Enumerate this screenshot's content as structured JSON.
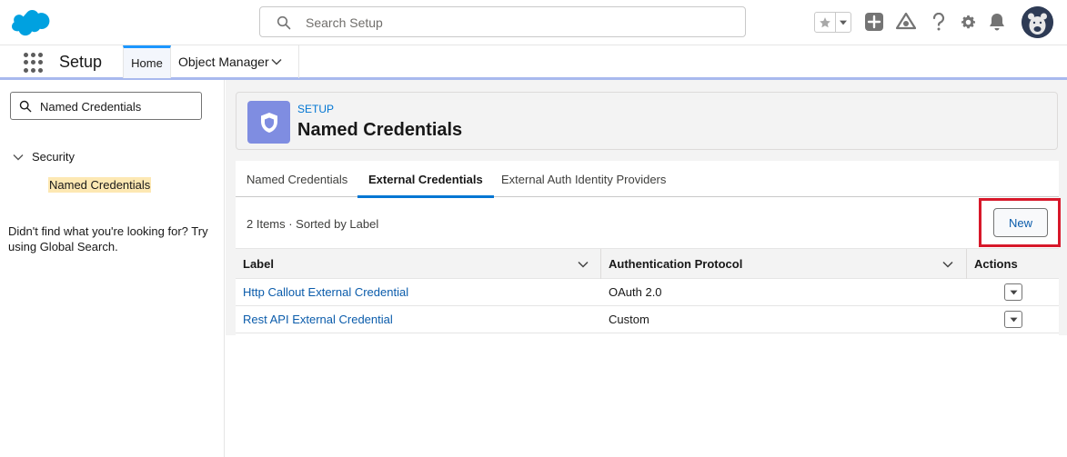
{
  "header": {
    "search_placeholder": "Search Setup",
    "brand_color": "#00a1e0",
    "icons": [
      "favorites-star-icon",
      "favorites-dropdown-icon",
      "global-actions-plus-icon",
      "trailhead-icon",
      "help-icon",
      "setup-gear-icon",
      "notifications-bell-icon",
      "user-avatar"
    ]
  },
  "app_nav": {
    "app_name": "Setup",
    "tabs": [
      {
        "label": "Home",
        "active": true
      },
      {
        "label": "Object Manager",
        "active": false
      }
    ]
  },
  "sidebar": {
    "quick_find_value": "Named Credentials",
    "tree": {
      "node_label": "Security",
      "leaf_label": "Named Credentials"
    },
    "not_found_text": "Didn't find what you're looking for? Try using Global Search."
  },
  "page_header": {
    "eyebrow": "SETUP",
    "title": "Named Credentials",
    "icon": "shield-icon"
  },
  "tabs": [
    {
      "label": "Named Credentials",
      "active": false
    },
    {
      "label": "External Credentials",
      "active": true
    },
    {
      "label": "External Auth Identity Providers",
      "active": false
    }
  ],
  "list": {
    "info": "2 Items · Sorted by Label",
    "new_button": "New",
    "columns": [
      "Label",
      "Authentication Protocol",
      "Actions"
    ],
    "rows": [
      {
        "label": "Http Callout External Credential",
        "protocol": "OAuth 2.0"
      },
      {
        "label": "Rest API External Credential",
        "protocol": "Custom"
      }
    ]
  },
  "colors": {
    "accent": "#0176d3",
    "highlight_box": "#d7182a",
    "header_icon_bg": "#7f8de1",
    "tree_highlight": "#fde8b3"
  }
}
